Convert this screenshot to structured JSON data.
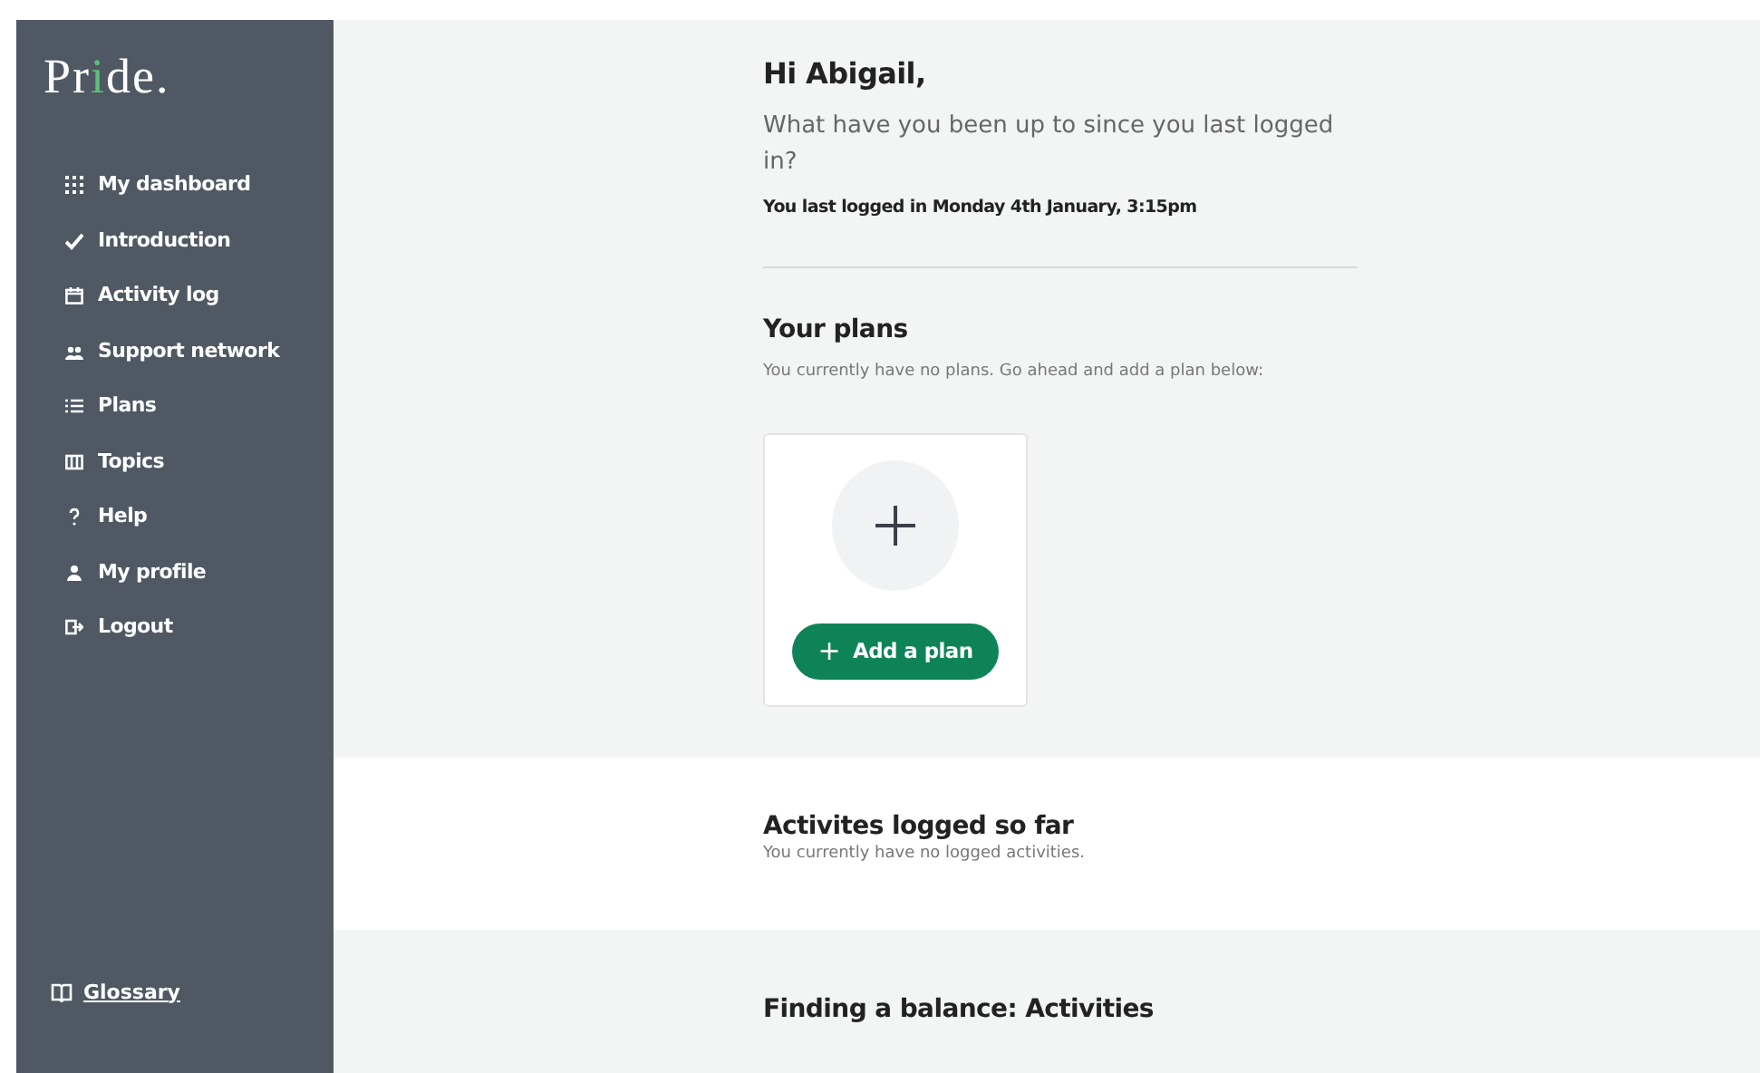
{
  "sidebar": {
    "logo": [
      {
        "text": "Pr",
        "accent": false
      },
      {
        "text": "i",
        "accent": true
      },
      {
        "text": "de.",
        "accent": false
      }
    ],
    "items": [
      {
        "label": "My dashboard"
      },
      {
        "label": "Introduction"
      },
      {
        "label": "Activity log"
      },
      {
        "label": "Support network"
      },
      {
        "label": "Plans"
      },
      {
        "label": "Topics"
      },
      {
        "label": "Help"
      },
      {
        "label": "My profile"
      },
      {
        "label": "Logout"
      }
    ],
    "glossary": "Glossary"
  },
  "greeting": {
    "title": "Hi Abigail,",
    "question": "What have you been up to since you last logged in?",
    "last_login": "You last logged in Monday 4th January, 3:15pm"
  },
  "plans": {
    "title": "Your plans",
    "message": "You currently have no plans. Go ahead and add a plan below:",
    "add_button": "Add a plan",
    "add_icon": "+"
  },
  "activities": {
    "title": "Activites logged so far",
    "message": "You currently have no logged activities."
  },
  "balance": {
    "title": "Finding a balance: Activities"
  }
}
